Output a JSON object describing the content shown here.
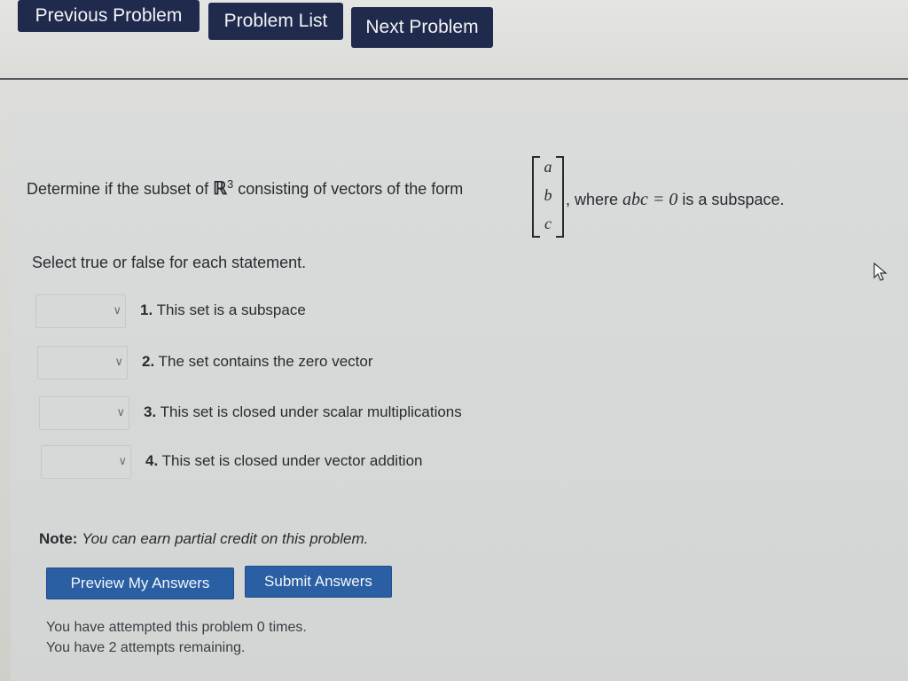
{
  "nav": {
    "previous": "Previous Problem",
    "list": "Problem List",
    "next": "Next Problem"
  },
  "problem": {
    "prompt_start": "Determine if the subset of ",
    "space_symbol": "ℝ",
    "space_dim": "3",
    "prompt_mid": " consisting of vectors of the form",
    "vector": [
      "a",
      "b",
      "c"
    ],
    "prompt_end_pre": ", where ",
    "condition": "abc = 0",
    "prompt_end_post": " is a subspace.",
    "instruction": "Select true or false for each statement.",
    "statements": [
      {
        "num": "1.",
        "text": "This set is a subspace",
        "selected": ""
      },
      {
        "num": "2.",
        "text": "The set contains the zero vector",
        "selected": ""
      },
      {
        "num": "3.",
        "text": "This set is closed under scalar multiplications",
        "selected": ""
      },
      {
        "num": "4.",
        "text": "This set is closed under vector addition",
        "selected": ""
      }
    ],
    "note_label": "Note:",
    "note_text": "You can earn partial credit on this problem."
  },
  "actions": {
    "preview": "Preview My Answers",
    "submit": "Submit Answers"
  },
  "status": {
    "attempted": "You have attempted this problem 0 times.",
    "remaining": "You have 2 attempts remaining."
  },
  "icons": {
    "select_chevron": "chevron-down-icon",
    "pointer": "cursor-icon"
  },
  "colors": {
    "nav_button": "#1f2a4d",
    "action_button": "#2a5fa3"
  }
}
